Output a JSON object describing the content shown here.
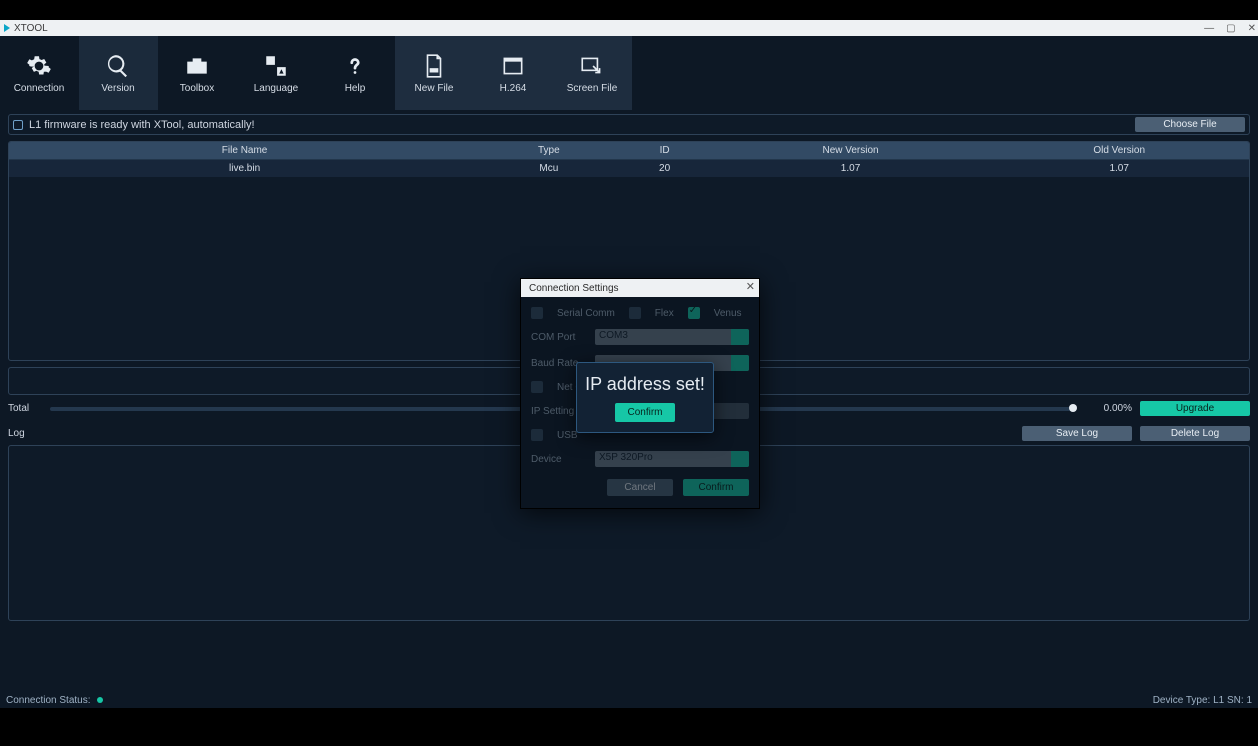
{
  "window": {
    "title": "XTOOL"
  },
  "toolbar": {
    "items": [
      {
        "label": "Connection"
      },
      {
        "label": "Version"
      },
      {
        "label": "Toolbox"
      },
      {
        "label": "Language"
      },
      {
        "label": "Help"
      },
      {
        "label": "New File"
      },
      {
        "label": "H.264"
      },
      {
        "label": "Screen File"
      }
    ]
  },
  "banner": {
    "text": "L1 firmware is ready with XTool, automatically!",
    "choose": "Choose File"
  },
  "table": {
    "headers": [
      "File Name",
      "Type",
      "ID",
      "New Version",
      "Old Version"
    ],
    "rows": [
      {
        "file": "live.bin",
        "type": "Mcu",
        "id": "20",
        "newv": "1.07",
        "oldv": "1.07"
      }
    ]
  },
  "progress": {
    "label": "Total",
    "value": "0.00%",
    "button": "Upgrade"
  },
  "log": {
    "label": "Log",
    "save": "Save Log",
    "delete": "Delete Log"
  },
  "status": {
    "left": "Connection Status:",
    "right": "Device Type:  L1  SN:  1"
  },
  "modal": {
    "title": "Connection Settings",
    "opt_serial": "Serial Comm",
    "opt_flex": "Flex",
    "opt_venus": "Venus",
    "com_label": "COM Port",
    "com_value": "COM3",
    "baud_label": "Baud Rate",
    "netc_label": "Net C",
    "ip_label": "IP Setting",
    "usb_label": "USB",
    "dev_label": "Device",
    "dev_value": "X5P 320Pro",
    "cancel": "Cancel",
    "confirm": "Confirm"
  },
  "alert": {
    "message": "IP address set!",
    "button": "Confirm"
  }
}
